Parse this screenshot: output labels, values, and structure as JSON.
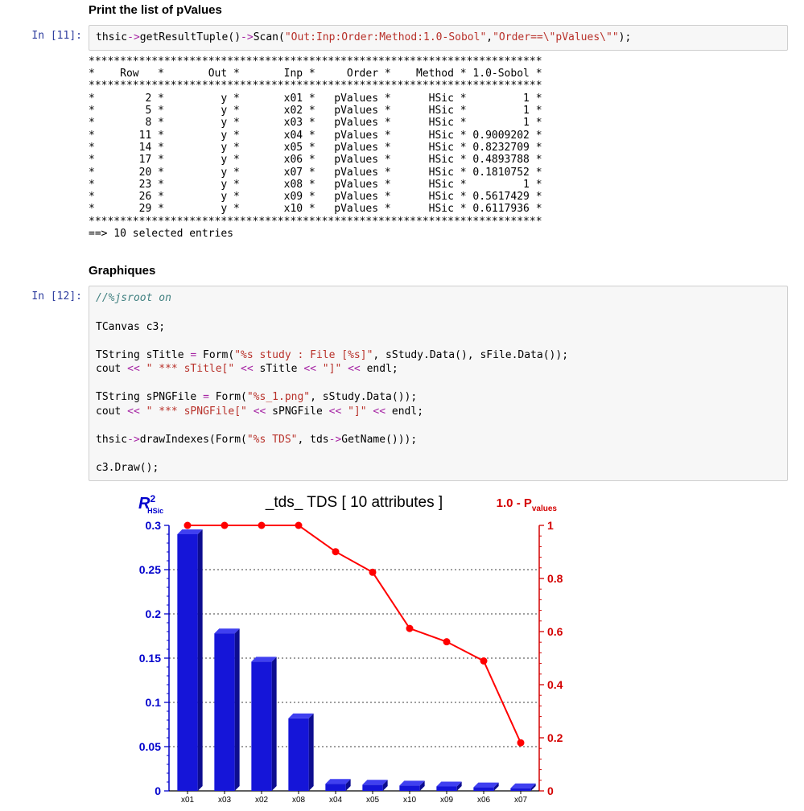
{
  "heading1": "Print the list of pValues",
  "prompt1": "In [11]:",
  "code1": {
    "p1a": "thsic",
    "p1b": "->",
    "p1c": "getResultTuple()",
    "p1d": "->",
    "p1e": "Scan(",
    "p1f": "\"Out:Inp:Order:Method:1.0-Sobol\"",
    "p1g": ",",
    "p1h": "\"Order==\\\"pValues\\\"\"",
    "p1i": ");"
  },
  "output1": "************************************************************************\n*    Row   *       Out *       Inp *     Order *    Method * 1.0-Sobol *\n************************************************************************\n*        2 *         y *       x01 *   pValues *      HSic *         1 *\n*        5 *         y *       x02 *   pValues *      HSic *         1 *\n*        8 *         y *       x03 *   pValues *      HSic *         1 *\n*       11 *         y *       x04 *   pValues *      HSic * 0.9009202 *\n*       14 *         y *       x05 *   pValues *      HSic * 0.8232709 *\n*       17 *         y *       x06 *   pValues *      HSic * 0.4893788 *\n*       20 *         y *       x07 *   pValues *      HSic * 0.1810752 *\n*       23 *         y *       x08 *   pValues *      HSic *         1 *\n*       26 *         y *       x09 *   pValues *      HSic * 0.5617429 *\n*       29 *         y *       x10 *   pValues *      HSic * 0.6117936 *\n************************************************************************\n==> 10 selected entries",
  "heading2": "Graphiques",
  "prompt2": "In [12]:",
  "code2": {
    "l1": "//%jsroot on",
    "l2": "TCanvas c3;",
    "l3a": "TString sTitle ",
    "l3b": "=",
    "l3c": " Form(",
    "l3d": "\"%s study : File [%s]\"",
    "l3e": ", sStudy.Data(), sFile.Data());",
    "l4a": "cout ",
    "l4b": "<<",
    "l4c": " ",
    "l4d": "\" *** sTitle[\"",
    "l4e": " ",
    "l4f": "<<",
    "l4g": " sTitle ",
    "l4h": "<<",
    "l4i": " ",
    "l4j": "\"]\"",
    "l4k": " ",
    "l4l": "<<",
    "l4m": " endl;",
    "l5a": "TString sPNGFile ",
    "l5b": "=",
    "l5c": " Form(",
    "l5d": "\"%s_1.png\"",
    "l5e": ", sStudy.Data());",
    "l6a": "cout ",
    "l6b": "<<",
    "l6c": " ",
    "l6d": "\" *** sPNGFile[\"",
    "l6e": " ",
    "l6f": "<<",
    "l6g": " sPNGFile ",
    "l6h": "<<",
    "l6i": " ",
    "l6j": "\"]\"",
    "l6k": " ",
    "l6l": "<<",
    "l6m": " endl;",
    "l7a": "thsic",
    "l7b": "->",
    "l7c": "drawIndexes(Form(",
    "l7d": "\"%s TDS\"",
    "l7e": ", tds",
    "l7f": "->",
    "l7g": "GetName()));",
    "l8": "c3.Draw();"
  },
  "chart_data": {
    "type": "bar+line",
    "title": "_tds_ TDS [ 10 attributes ]",
    "ylabel_left_sup": "2",
    "ylabel_left": "R",
    "ylabel_left_sub": "HSic",
    "ylabel_right": "1.0 - P",
    "ylabel_right_sub": "values",
    "ylim_left": [
      0,
      0.3
    ],
    "yticks_left": [
      0,
      0.05,
      0.1,
      0.15,
      0.2,
      0.25,
      0.3
    ],
    "ylim_right": [
      0,
      1
    ],
    "yticks_right": [
      0,
      0.2,
      0.4,
      0.6,
      0.8,
      1
    ],
    "categories": [
      "x01",
      "x03",
      "x02",
      "x08",
      "x04",
      "x05",
      "x10",
      "x09",
      "x06",
      "x07"
    ],
    "series": [
      {
        "name": "R2_HSic_bars",
        "axis": "left",
        "type": "bar",
        "values": [
          0.29,
          0.178,
          0.146,
          0.082,
          0.008,
          0.007,
          0.006,
          0.005,
          0.004,
          0.003
        ]
      },
      {
        "name": "one_minus_P_line",
        "axis": "right",
        "type": "line",
        "values": [
          1.0,
          1.0,
          1.0,
          1.0,
          0.9009,
          0.8233,
          0.6118,
          0.5617,
          0.4894,
          0.1811
        ]
      }
    ]
  }
}
